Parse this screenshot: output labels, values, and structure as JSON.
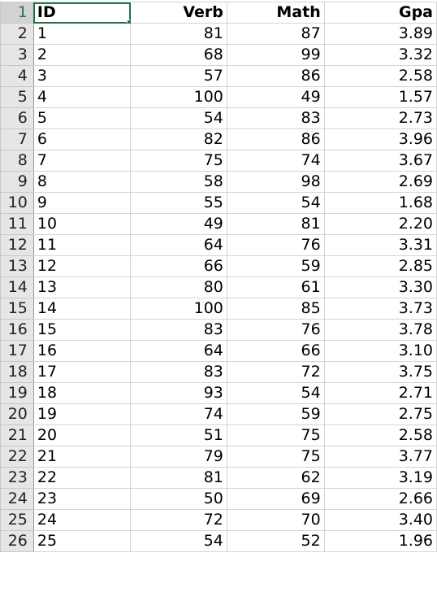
{
  "sheet": {
    "active_cell": "A1",
    "headers": [
      "ID",
      "Verb",
      "Math",
      "Gpa"
    ],
    "rows": [
      [
        "1",
        "81",
        "87",
        "3.89"
      ],
      [
        "2",
        "68",
        "99",
        "3.32"
      ],
      [
        "3",
        "57",
        "86",
        "2.58"
      ],
      [
        "4",
        "100",
        "49",
        "1.57"
      ],
      [
        "5",
        "54",
        "83",
        "2.73"
      ],
      [
        "6",
        "82",
        "86",
        "3.96"
      ],
      [
        "7",
        "75",
        "74",
        "3.67"
      ],
      [
        "8",
        "58",
        "98",
        "2.69"
      ],
      [
        "9",
        "55",
        "54",
        "1.68"
      ],
      [
        "10",
        "49",
        "81",
        "2.20"
      ],
      [
        "11",
        "64",
        "76",
        "3.31"
      ],
      [
        "12",
        "66",
        "59",
        "2.85"
      ],
      [
        "13",
        "80",
        "61",
        "3.30"
      ],
      [
        "14",
        "100",
        "85",
        "3.73"
      ],
      [
        "15",
        "83",
        "76",
        "3.78"
      ],
      [
        "16",
        "64",
        "66",
        "3.10"
      ],
      [
        "17",
        "83",
        "72",
        "3.75"
      ],
      [
        "18",
        "93",
        "54",
        "2.71"
      ],
      [
        "19",
        "74",
        "59",
        "2.75"
      ],
      [
        "20",
        "51",
        "75",
        "2.58"
      ],
      [
        "21",
        "79",
        "75",
        "3.77"
      ],
      [
        "22",
        "81",
        "62",
        "3.19"
      ],
      [
        "23",
        "50",
        "69",
        "2.66"
      ],
      [
        "24",
        "72",
        "70",
        "3.40"
      ],
      [
        "25",
        "54",
        "52",
        "1.96"
      ]
    ],
    "row_numbers": [
      "1",
      "2",
      "3",
      "4",
      "5",
      "6",
      "7",
      "8",
      "9",
      "10",
      "11",
      "12",
      "13",
      "14",
      "15",
      "16",
      "17",
      "18",
      "19",
      "20",
      "21",
      "22",
      "23",
      "24",
      "25",
      "26"
    ],
    "accent_color": "#217346"
  }
}
